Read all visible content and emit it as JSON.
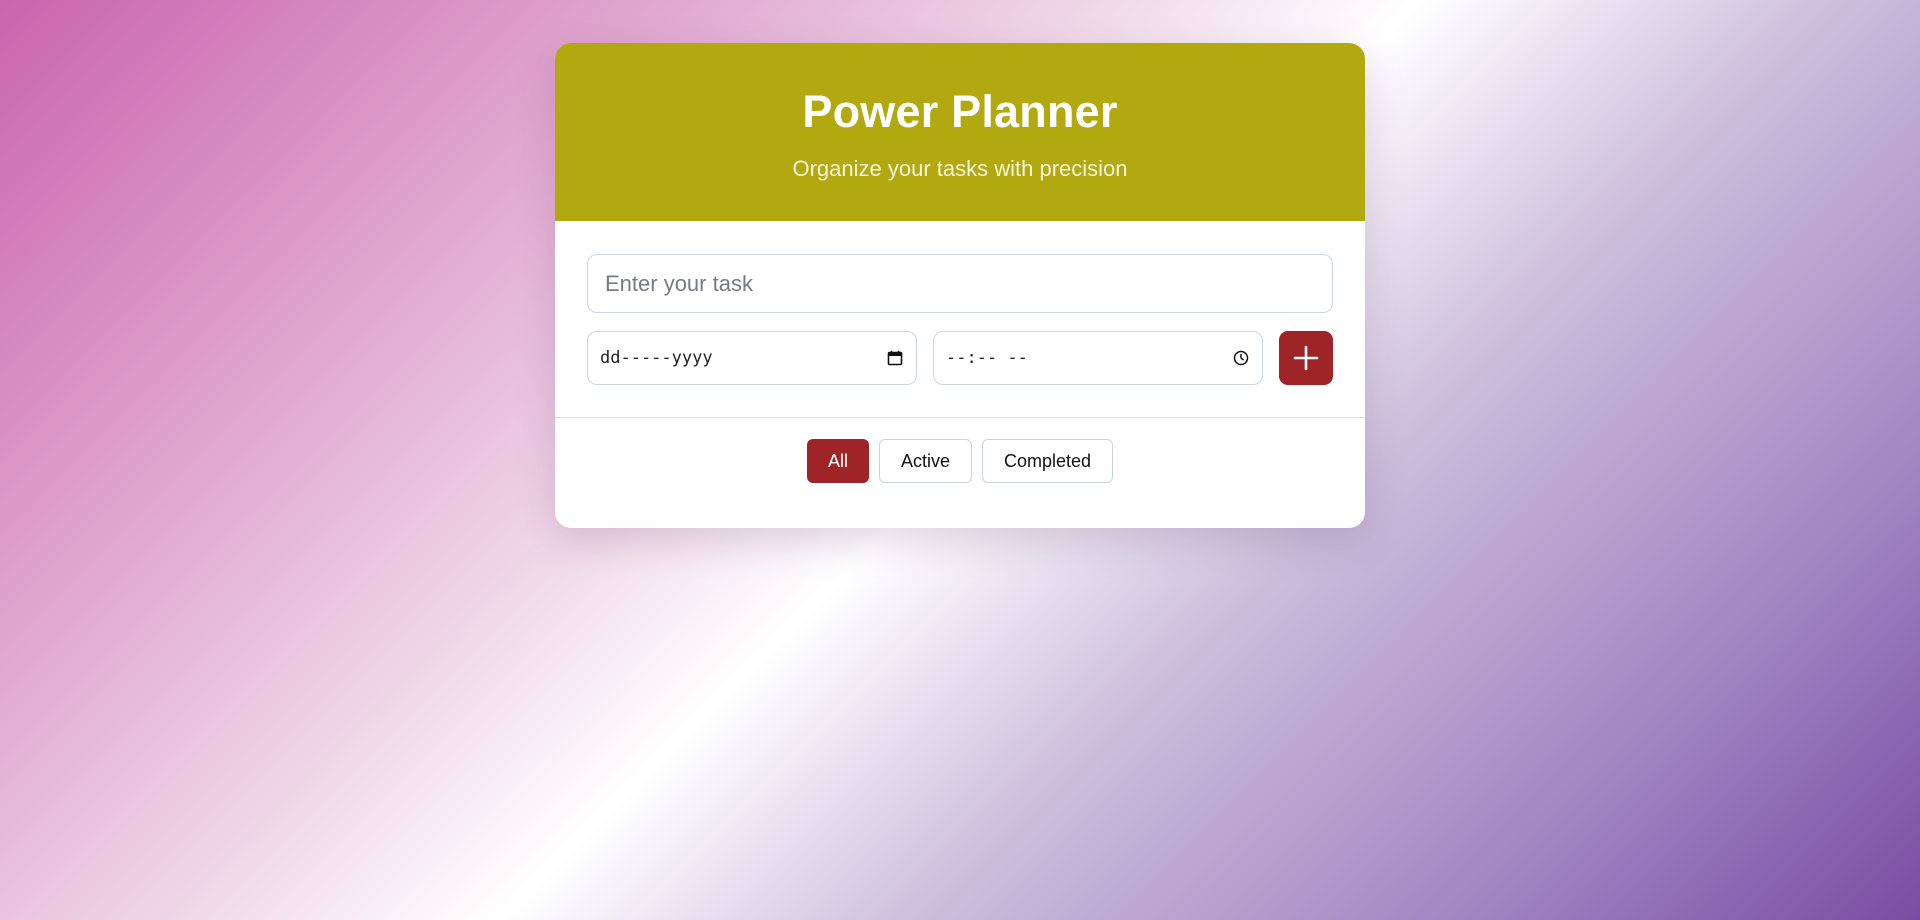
{
  "header": {
    "title": "Power Planner",
    "subtitle": "Organize your tasks with precision"
  },
  "form": {
    "task_placeholder": "Enter your task",
    "date_placeholder": "dd-----yyyy",
    "time_placeholder": "--:-- --",
    "add_icon": "plus-icon",
    "date_icon": "calendar-icon",
    "time_icon": "clock-icon"
  },
  "filters": {
    "items": [
      {
        "label": "All",
        "active": true
      },
      {
        "label": "Active",
        "active": false
      },
      {
        "label": "Completed",
        "active": false
      }
    ]
  },
  "colors": {
    "header_bg": "#b2a80f",
    "accent": "#9e2428",
    "card_bg": "#ffffff"
  }
}
